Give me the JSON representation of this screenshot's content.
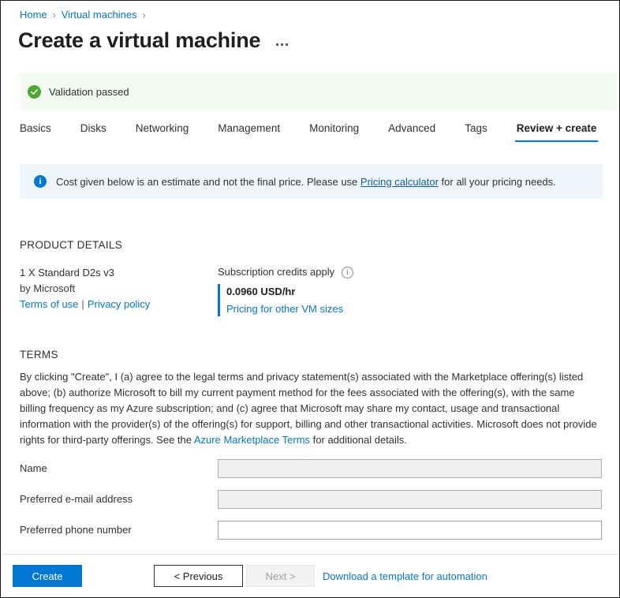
{
  "breadcrumb": {
    "items": [
      {
        "label": "Home"
      },
      {
        "label": "Virtual machines"
      }
    ],
    "separator": "›"
  },
  "header": {
    "title": "Create a virtual machine",
    "more_menu": "..."
  },
  "validation": {
    "icon": "check-circle-icon",
    "text": "Validation passed",
    "background": "#f3faf1",
    "icon_color": "#4ea72e"
  },
  "tabs": [
    {
      "label": "Basics",
      "active": false
    },
    {
      "label": "Disks",
      "active": false
    },
    {
      "label": "Networking",
      "active": false
    },
    {
      "label": "Management",
      "active": false
    },
    {
      "label": "Monitoring",
      "active": false
    },
    {
      "label": "Advanced",
      "active": false
    },
    {
      "label": "Tags",
      "active": false
    },
    {
      "label": "Review + create",
      "active": true
    }
  ],
  "info_banner": {
    "icon": "info-icon",
    "text_before": "Cost given below is an estimate and not the final price. Please use",
    "link": "Pricing calculator",
    "text_after": "for all your pricing needs.",
    "background": "#eff6fc",
    "icon_color": "#0078d4"
  },
  "product_details": {
    "heading": "PRODUCT DETAILS",
    "product_name": "1 X Standard D2s v3",
    "publisher": "by Microsoft",
    "terms_of_use_link": "Terms of use",
    "separator": "|",
    "privacy_policy_link": "Privacy policy",
    "credits_label": "Subscription credits apply",
    "credits_info_icon": "info-outline-icon",
    "price": "0.0960 USD/hr",
    "price_link": "Pricing for other VM sizes",
    "accent_color": "#0078d4"
  },
  "terms": {
    "heading": "TERMS",
    "paragraph_before": "By clicking \"Create\", I (a) agree to the legal terms and privacy statement(s) associated with the Marketplace offering(s) listed above; (b) authorize Microsoft to bill my current payment method for the fees associated with the offering(s), with the same billing frequency as my Azure subscription; and (c) agree that Microsoft may share my contact, usage and transactional information with the provider(s) of the offering(s) for support, billing and other transactional activities. Microsoft does not provide rights for third-party offerings. See the",
    "link": "Azure Marketplace Terms",
    "paragraph_after": "for additional details."
  },
  "form": {
    "fields": [
      {
        "label": "Name",
        "value": "",
        "placeholder": "",
        "disabled": true
      },
      {
        "label": "Preferred e-mail address",
        "value": "",
        "placeholder": "",
        "disabled": true
      },
      {
        "label": "Preferred phone number",
        "value": "",
        "placeholder": "",
        "disabled": false
      }
    ]
  },
  "footer": {
    "create_label": "Create",
    "previous_label": "< Previous",
    "next_label": "Next >",
    "next_disabled": true,
    "download_link": "Download a template for automation",
    "primary_color": "#0078d4"
  }
}
